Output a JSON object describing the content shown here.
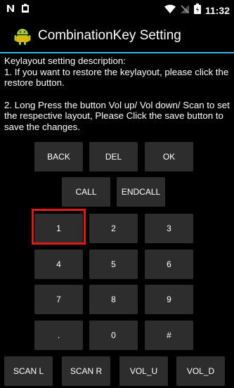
{
  "status_bar": {
    "time": "11:32"
  },
  "app": {
    "title": "CombinationKey Setting"
  },
  "description": {
    "heading": "Keylayout setting description:",
    "step1": " 1. If you want to restore the keylayout, please click the restore button.",
    "step2": " 2. Long Press the button Vol up/ Vol down/ Scan to set the respective layout, Please Click the save button to save the changes."
  },
  "keys": {
    "row1": [
      "BACK",
      "DEL",
      "OK"
    ],
    "row2": [
      "CALL",
      "ENDCALL"
    ],
    "row3": [
      "1",
      "2",
      "3"
    ],
    "row4": [
      "4",
      "5",
      "6"
    ],
    "row5": [
      "7",
      "8",
      "9"
    ],
    "row6": [
      ".",
      "0",
      "#"
    ],
    "bottom": [
      "SCAN L",
      "SCAN R",
      "VOL_U",
      "VOL_D"
    ]
  },
  "colors": {
    "accent": "#33b5e5",
    "highlight": "#e01a1a",
    "button": "#2d2d2d"
  }
}
